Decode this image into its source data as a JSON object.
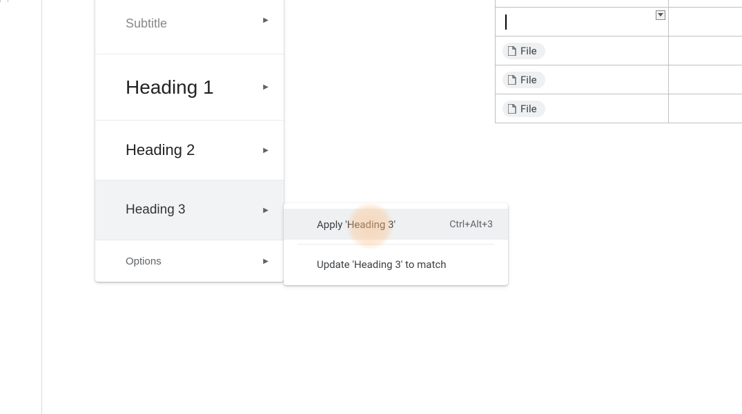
{
  "styles_menu": {
    "subtitle": "Subtitle",
    "h1": "Heading 1",
    "h2": "Heading 2",
    "h3": "Heading 3",
    "options": "Options"
  },
  "submenu": {
    "apply": "Apply 'Heading 3'",
    "apply_shortcut": "Ctrl+Alt+3",
    "update": "Update 'Heading 3' to match"
  },
  "table": {
    "editing_value": "",
    "rows": [
      {
        "chip": "File"
      },
      {
        "chip": "File"
      },
      {
        "chip": "File"
      }
    ]
  }
}
